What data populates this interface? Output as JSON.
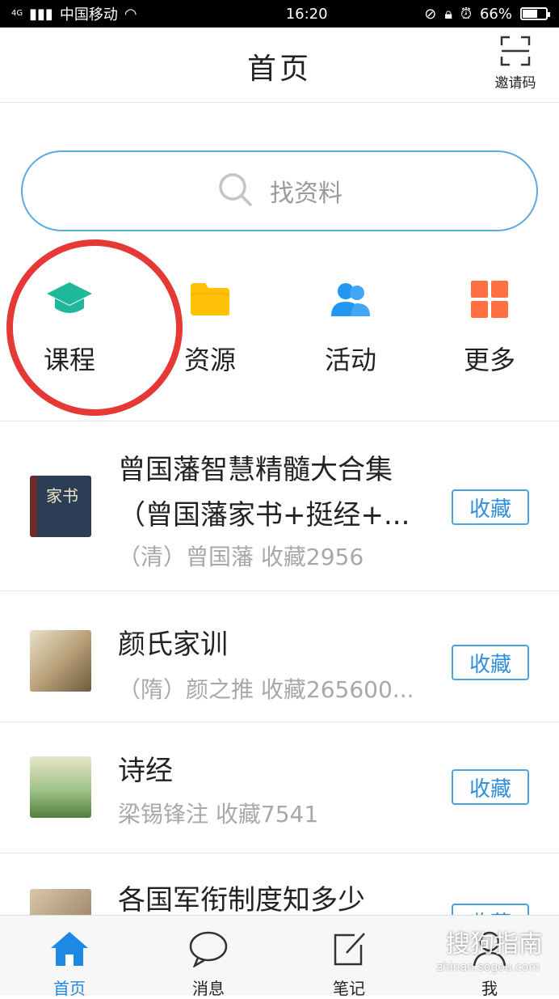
{
  "status_bar": {
    "network": "4G",
    "carrier": "中国移动",
    "time": "16:20",
    "battery_percent": "66%",
    "battery_level": 0.66
  },
  "header": {
    "title": "首页",
    "invite_label": "邀请码",
    "invite_icon": "scan-icon"
  },
  "search": {
    "placeholder": "找资料",
    "icon": "search-icon"
  },
  "categories": [
    {
      "label": "课程",
      "icon": "graduation-cap-icon",
      "color": "#1fb89a"
    },
    {
      "label": "资源",
      "icon": "folder-icon",
      "color": "#ffc107"
    },
    {
      "label": "活动",
      "icon": "users-icon",
      "color": "#2196f3"
    },
    {
      "label": "更多",
      "icon": "grid-icon",
      "color": "#ff7043"
    }
  ],
  "list": [
    {
      "title_line1": "曾国藩智慧精髓大合集",
      "title_line2": "（曾国藩家书+挺经+...",
      "meta": "（清）曾国藩 收藏2956",
      "button": "收藏",
      "cover_text": "家书"
    },
    {
      "title_line1": "颜氏家训",
      "meta": "（隋）颜之推 收藏265600...",
      "button": "收藏"
    },
    {
      "title_line1": "诗经",
      "meta": "梁锡锋注 收藏7541",
      "button": "收藏"
    },
    {
      "title_line1": "各国军衔制度知多少",
      "button": "收藏"
    }
  ],
  "tabbar": [
    {
      "label": "首页",
      "icon": "home-icon",
      "active": true
    },
    {
      "label": "消息",
      "icon": "chat-bubble-icon",
      "active": false
    },
    {
      "label": "笔记",
      "icon": "edit-note-icon",
      "active": false
    },
    {
      "label": "我",
      "icon": "person-icon",
      "active": false
    }
  ],
  "watermark": {
    "text": "搜狗指南",
    "sub": "zhinan.sogou.com"
  },
  "accent_color": "#1e88e5"
}
